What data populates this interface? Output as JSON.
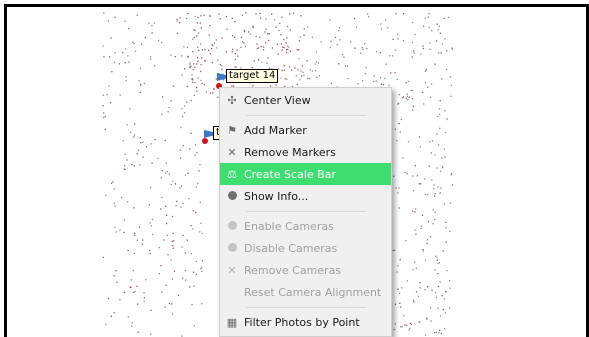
{
  "markers": [
    {
      "label": "target 14"
    },
    {
      "label": "ta"
    }
  ],
  "context_menu": {
    "items": [
      {
        "label": "Center View",
        "icon": "move-icon",
        "state": "normal"
      },
      {
        "separator": true
      },
      {
        "label": "Add Marker",
        "icon": "flag-icon",
        "state": "normal"
      },
      {
        "label": "Remove Markers",
        "icon": "x-icon",
        "state": "normal"
      },
      {
        "label": "Create Scale Bar",
        "icon": "scale-bar-icon",
        "state": "highlighted"
      },
      {
        "label": "Show Info...",
        "icon": "info-icon",
        "state": "normal"
      },
      {
        "separator": true
      },
      {
        "label": "Enable Cameras",
        "icon": "camera-enable-icon",
        "state": "disabled"
      },
      {
        "label": "Disable Cameras",
        "icon": "camera-disable-icon",
        "state": "disabled"
      },
      {
        "label": "Remove Cameras",
        "icon": "x-icon",
        "state": "disabled"
      },
      {
        "label": "Reset Camera Alignment",
        "icon": "",
        "state": "disabled"
      },
      {
        "separator": true
      },
      {
        "label": "Filter Photos by Point",
        "icon": "filter-icon",
        "state": "normal"
      }
    ]
  },
  "colors": {
    "highlight": "#3ddd70",
    "marker_flag": "#3b78c8",
    "marker_dot": "#d0121b",
    "tie_point": "#9b5a5a"
  }
}
